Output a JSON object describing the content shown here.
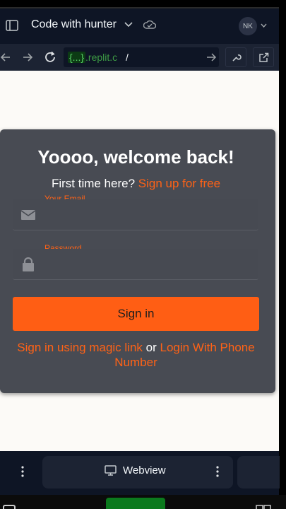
{
  "header": {
    "repl_title": "Code with hunter",
    "avatar_initials": "NK"
  },
  "urlbar": {
    "host_tag": "{...}",
    "host_rest": ".replit.c",
    "path": "/"
  },
  "login_card": {
    "title": "Yoooo, welcome back!",
    "signup_prompt": "First time here?",
    "signup_link": "Sign up for free",
    "email_label": "Your Email",
    "email_value": "",
    "password_label": "Password",
    "password_value": "",
    "signin_button": "Sign in",
    "magic_link": "Sign in using magic link",
    "or_text": "or",
    "phone_link": "Login With Phone Number"
  },
  "bottombar": {
    "webview_label": "Webview"
  },
  "colors": {
    "accent_orange": "#ff6216",
    "card_bg": "#484b53",
    "app_bg": "#0e1525",
    "url_host_green": "#3d9b44"
  }
}
